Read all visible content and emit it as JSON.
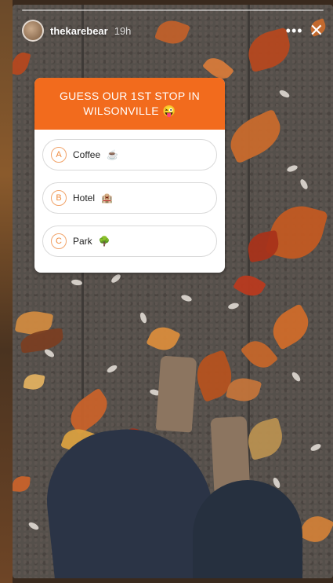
{
  "story": {
    "username": "thekarebear",
    "timestamp": "19h",
    "more_icon": "more-icon",
    "close_icon": "close-icon"
  },
  "quiz": {
    "question": "GUESS OUR 1ST STOP IN WILSONVILLE 😜",
    "options": [
      {
        "letter": "A",
        "label": "Coffee",
        "emoji": "☕"
      },
      {
        "letter": "B",
        "label": "Hotel",
        "emoji": "🏨"
      },
      {
        "letter": "C",
        "label": "Park",
        "emoji": "🌳"
      }
    ],
    "accent_color": "#f26b1d"
  }
}
